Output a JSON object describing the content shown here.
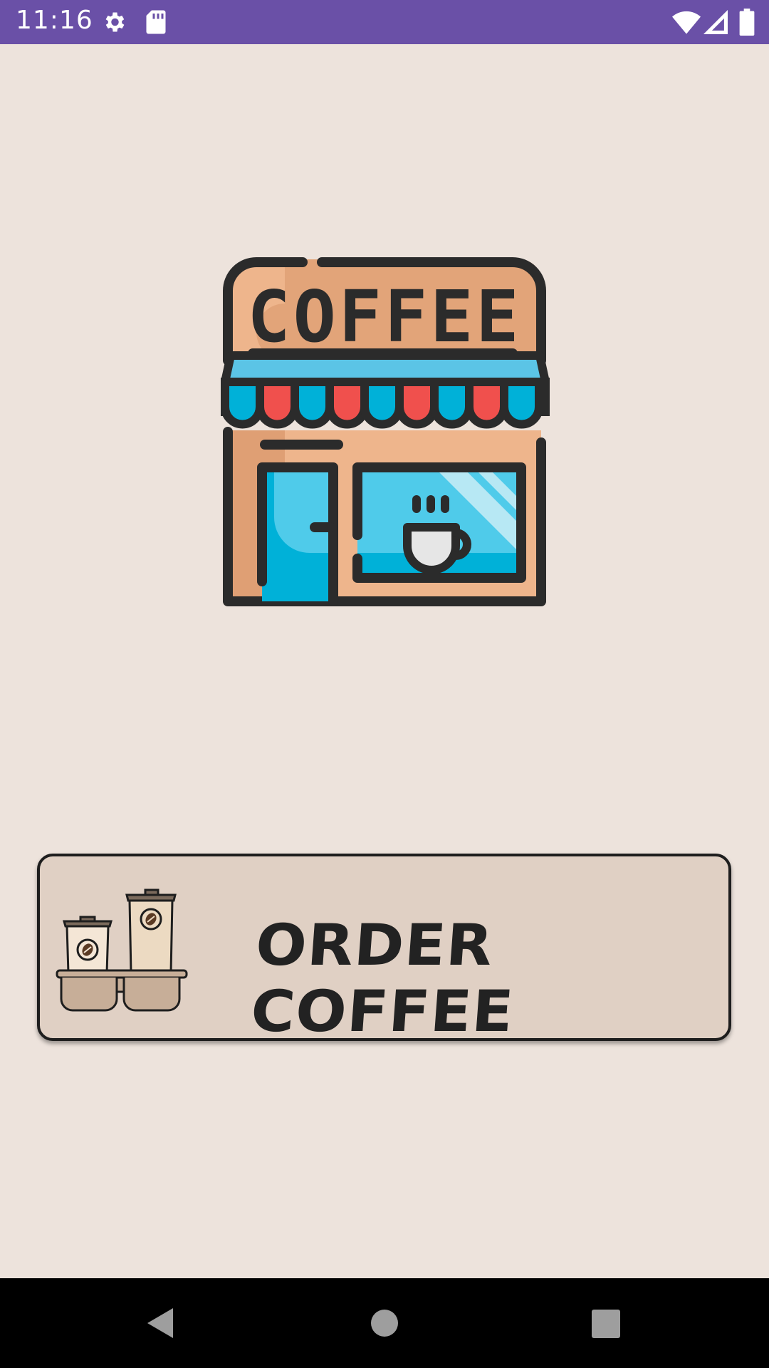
{
  "status_bar": {
    "time": "11:16",
    "icons": [
      "settings-gear-icon",
      "sd-card-icon",
      "wifi-icon",
      "signal-icon",
      "battery-icon"
    ],
    "background": "#6a50a7"
  },
  "main": {
    "shop_sign_text": "COFFEE",
    "order_button": {
      "label": "ORDER COFFEE",
      "icon": "coffee-cups-carrier-icon"
    },
    "background": "#ede3dc"
  },
  "nav_bar": {
    "icons": [
      "back-icon",
      "home-icon",
      "recents-icon"
    ]
  }
}
